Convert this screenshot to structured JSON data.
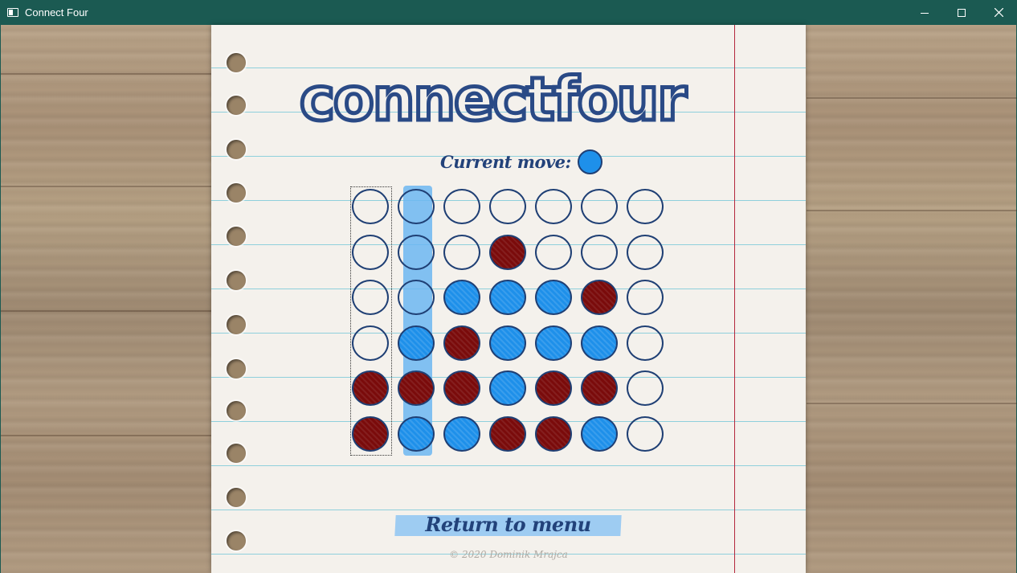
{
  "window": {
    "title": "Connect Four",
    "minimize_icon": "minimize-icon",
    "maximize_icon": "maximize-icon",
    "close_icon": "close-icon"
  },
  "game": {
    "logo_text": "connectfour",
    "current_move_label": "Current move:",
    "current_player": "blue",
    "selected_column": 0,
    "highlighted_column": 1,
    "colors": {
      "red": "#7a0b0b",
      "blue": "#1e90ea",
      "ink": "#1f3f74"
    },
    "board": [
      [
        "empty",
        "empty",
        "empty",
        "empty",
        "empty",
        "empty",
        "empty"
      ],
      [
        "empty",
        "empty",
        "empty",
        "red",
        "empty",
        "empty",
        "empty"
      ],
      [
        "empty",
        "empty",
        "blue",
        "blue",
        "blue",
        "red",
        "empty"
      ],
      [
        "empty",
        "blue",
        "red",
        "blue",
        "blue",
        "blue",
        "empty"
      ],
      [
        "red",
        "red",
        "red",
        "blue",
        "red",
        "red",
        "empty"
      ],
      [
        "red",
        "blue",
        "blue",
        "red",
        "red",
        "blue",
        "empty"
      ]
    ]
  },
  "menu": {
    "return_label": "Return to menu"
  },
  "footer": {
    "copyright": "© 2020 Dominik Mrajca"
  }
}
